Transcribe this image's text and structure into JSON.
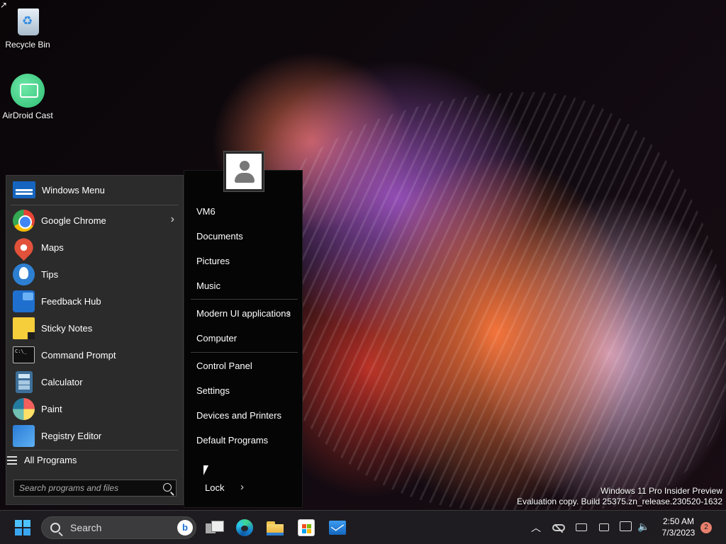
{
  "desktop": {
    "icons": [
      {
        "label": "Recycle Bin",
        "icon": "recycle-bin-icon"
      },
      {
        "label": "AirDroid Cast",
        "icon": "airdroid-cast-icon"
      }
    ]
  },
  "start_menu": {
    "left": {
      "header": {
        "label": "Windows Menu",
        "icon": "windows-menu-icon"
      },
      "items": [
        {
          "label": "Google Chrome",
          "icon": "chrome-icon",
          "has_submenu": true
        },
        {
          "label": "Maps",
          "icon": "maps-icon"
        },
        {
          "label": "Tips",
          "icon": "tips-icon"
        },
        {
          "label": "Feedback Hub",
          "icon": "feedback-hub-icon"
        },
        {
          "label": "Sticky Notes",
          "icon": "sticky-notes-icon"
        },
        {
          "label": "Command Prompt",
          "icon": "command-prompt-icon"
        },
        {
          "label": "Calculator",
          "icon": "calculator-icon"
        },
        {
          "label": "Paint",
          "icon": "paint-icon"
        },
        {
          "label": "Registry Editor",
          "icon": "registry-editor-icon"
        }
      ],
      "all_programs": "All Programs",
      "search_placeholder": "Search programs and files"
    },
    "right": {
      "user_folder": "VM6",
      "group1": [
        "Documents",
        "Pictures",
        "Music"
      ],
      "modern_ui": "Modern UI applications",
      "computer": "Computer",
      "group2": [
        "Control Panel",
        "Settings",
        "Devices and Printers",
        "Default Programs"
      ],
      "power": "Lock"
    }
  },
  "watermark": {
    "line1": "Windows 11 Pro Insider Preview",
    "line2": "Evaluation copy. Build 25375.zn_release.230520-1632"
  },
  "taskbar": {
    "search_label": "Search",
    "apps": [
      "task-view-icon",
      "edge-icon",
      "file-explorer-icon",
      "microsoft-store-icon",
      "mail-icon"
    ],
    "time": "2:50 AM",
    "date": "7/3/2023",
    "notification_count": "2"
  },
  "colors": {
    "menu_left_bg": "#2b2b2b",
    "menu_right_bg": "#050505",
    "accent": "#4cc2ff"
  }
}
